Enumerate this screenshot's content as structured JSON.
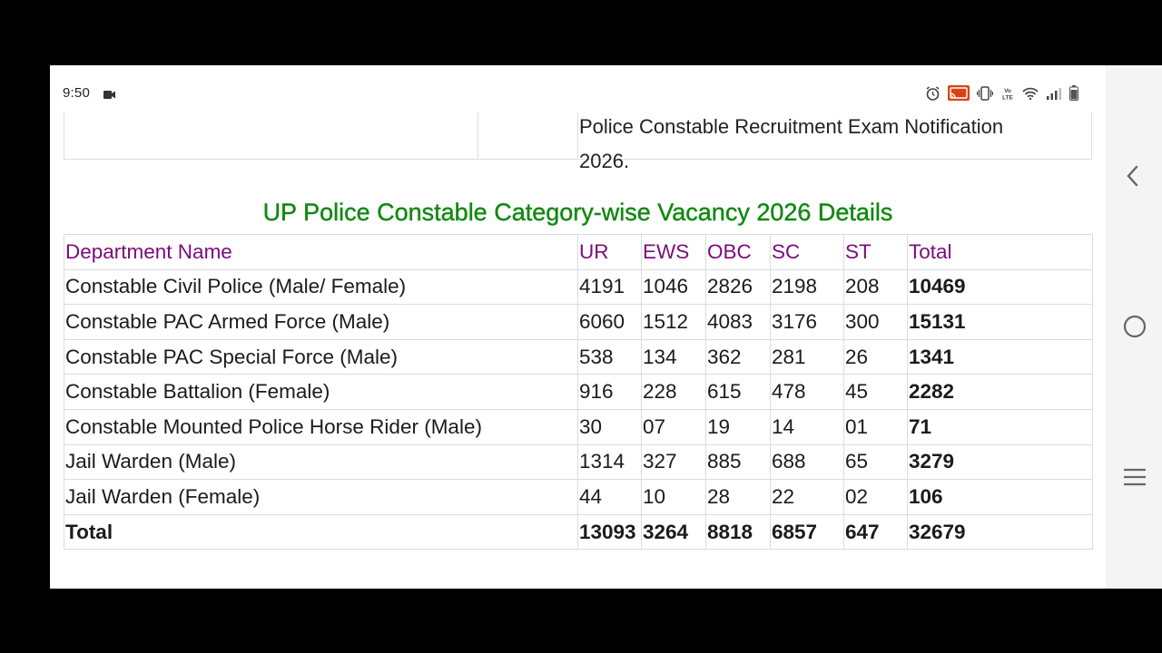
{
  "status_bar": {
    "time": "9:50",
    "icons": [
      "video-camera-icon",
      "alarm-icon",
      "cast-icon",
      "vibrate-icon",
      "volte-icon",
      "wifi-icon",
      "signal-icon",
      "battery-icon"
    ],
    "volte_text": "VoLTE"
  },
  "previous_section": {
    "text_line1": "Police Constable Recruitment Exam Notification",
    "text_line2": "2026."
  },
  "heading": "UP Police Constable Category-wise Vacancy 2026 Details",
  "table": {
    "headers": [
      "Department Name",
      "UR",
      "EWS",
      "OBC",
      "SC",
      "ST",
      "Total"
    ],
    "rows": [
      [
        "Constable Civil Police (Male/ Female)",
        "4191",
        "1046",
        "2826",
        "2198",
        "208",
        "10469"
      ],
      [
        "Constable PAC Armed Force (Male)",
        "6060",
        "1512",
        "4083",
        "3176",
        "300",
        "15131"
      ],
      [
        "Constable PAC Special Force (Male)",
        "538",
        "134",
        "362",
        "281",
        "26",
        "1341"
      ],
      [
        "Constable Battalion (Female)",
        "916",
        "228",
        "615",
        "478",
        "45",
        "2282"
      ],
      [
        "Constable Mounted Police Horse Rider (Male)",
        "30",
        "07",
        "19",
        "14",
        "01",
        "71"
      ],
      [
        "Jail Warden (Male)",
        "1314",
        "327",
        "885",
        "688",
        "65",
        "3279"
      ],
      [
        "Jail Warden (Female)",
        "44",
        "10",
        "28",
        "22",
        "02",
        "106"
      ],
      [
        "Total",
        "13093",
        "3264",
        "8818",
        "6857",
        "647",
        "32679"
      ]
    ]
  },
  "colors": {
    "heading": "#118811",
    "header_text": "#7b0b7b",
    "border": "#dcdcdc"
  },
  "nav_bar": {
    "icons": [
      "back-chevron-icon",
      "home-circle-icon",
      "recents-menu-icon"
    ]
  }
}
